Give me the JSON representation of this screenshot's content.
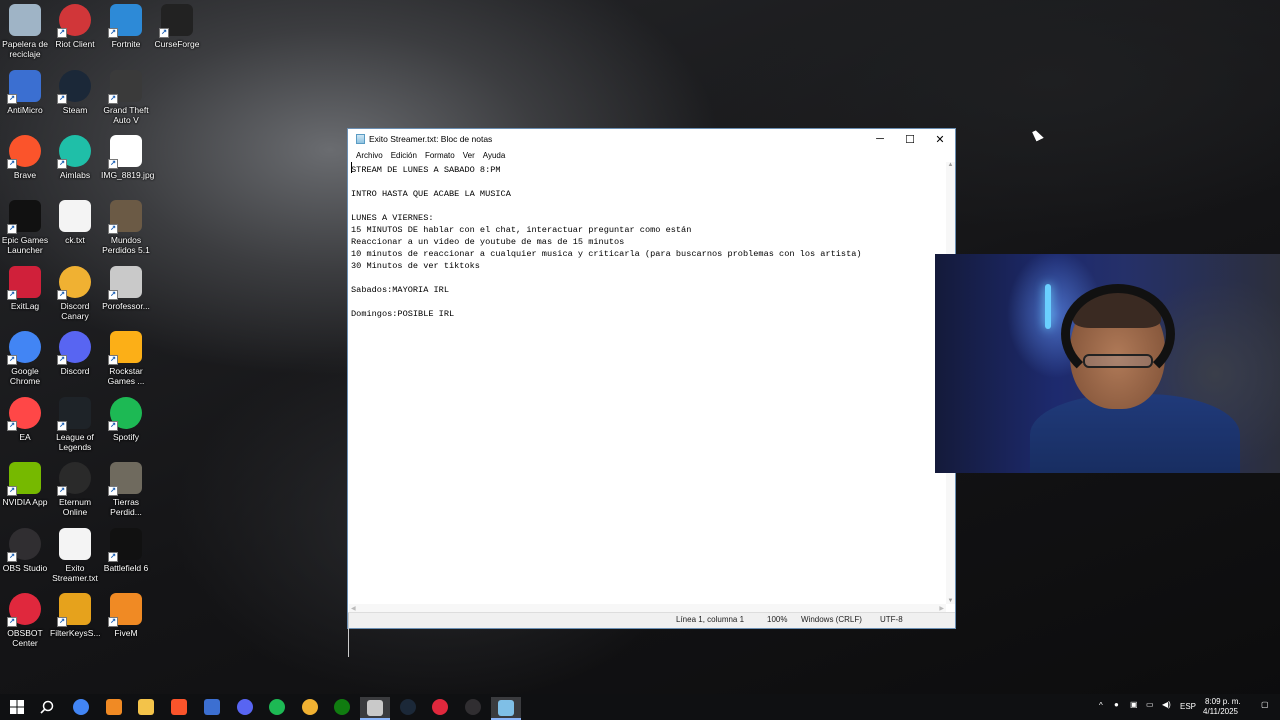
{
  "desktop": {
    "icons": [
      {
        "label": "Papelera de reciclaje",
        "icon": "recycle-bin-icon",
        "color": "#9fb4c6"
      },
      {
        "label": "Riot Client",
        "icon": "riot-client-icon",
        "color": "#d13639"
      },
      {
        "label": "Fortnite",
        "icon": "fortnite-icon",
        "color": "#2d8ad7"
      },
      {
        "label": "CurseForge",
        "icon": "curseforge-icon",
        "color": "#222222"
      },
      {
        "label": "AntiMicro",
        "icon": "antimicro-icon",
        "color": "#3b6fd1"
      },
      {
        "label": "Steam",
        "icon": "steam-icon",
        "color": "#1b2838"
      },
      {
        "label": "Grand Theft Auto V",
        "icon": "gta-v-icon",
        "color": "#3a3a3a"
      },
      {
        "label": "Brave",
        "icon": "brave-icon",
        "color": "#fb542b"
      },
      {
        "label": "Aimlabs",
        "icon": "aimlabs-icon",
        "color": "#1fbfa8"
      },
      {
        "label": "IMG_8819.jpg",
        "icon": "image-file-icon",
        "color": "#ffffff"
      },
      {
        "label": "Epic Games Launcher",
        "icon": "epic-games-icon",
        "color": "#111111"
      },
      {
        "label": "ck.txt",
        "icon": "text-file-icon",
        "color": "#f4f4f4"
      },
      {
        "label": "Mundos Perdidos 5.1",
        "icon": "mundos-perdidos-icon",
        "color": "#6b5a45"
      },
      {
        "label": "ExitLag",
        "icon": "exitlag-icon",
        "color": "#d0203a"
      },
      {
        "label": "Discord Canary",
        "icon": "discord-canary-icon",
        "color": "#f0b132"
      },
      {
        "label": "Porofessor...",
        "icon": "porofessor-icon",
        "color": "#c9c9c9"
      },
      {
        "label": "Google Chrome",
        "icon": "chrome-icon",
        "color": "#4285f4"
      },
      {
        "label": "Discord",
        "icon": "discord-icon",
        "color": "#5865f2"
      },
      {
        "label": "Rockstar Games ...",
        "icon": "rockstar-icon",
        "color": "#fcaf17"
      },
      {
        "label": "EA",
        "icon": "ea-icon",
        "color": "#ff4747"
      },
      {
        "label": "League of Legends",
        "icon": "league-of-legends-icon",
        "color": "#1e2328"
      },
      {
        "label": "Spotify",
        "icon": "spotify-icon",
        "color": "#1db954"
      },
      {
        "label": "NVIDIA App",
        "icon": "nvidia-icon",
        "color": "#76b900"
      },
      {
        "label": "Eternum Online",
        "icon": "eternum-icon",
        "color": "#2a2a2a"
      },
      {
        "label": "Tierras Perdid...",
        "icon": "tierras-perdidas-icon",
        "color": "#6f6a5e"
      },
      {
        "label": "OBS Studio",
        "icon": "obs-icon",
        "color": "#302e31"
      },
      {
        "label": "Exito Streamer.txt",
        "icon": "text-file-icon",
        "color": "#f4f4f4"
      },
      {
        "label": "Battlefield 6",
        "icon": "battlefield-icon",
        "color": "#111111"
      },
      {
        "label": "OBSBOT Center",
        "icon": "obsbot-icon",
        "color": "#e0283d"
      },
      {
        "label": "FilterKeysS...",
        "icon": "filterkeys-icon",
        "color": "#e6a21c"
      },
      {
        "label": "FiveM",
        "icon": "fivem-icon",
        "color": "#f08a24"
      }
    ]
  },
  "notepad": {
    "title": "Exito Streamer.txt: Bloc de notas",
    "controls": {
      "minimize": "─",
      "maximize": "☐",
      "close": "✕"
    },
    "menu": [
      "Archivo",
      "Edición",
      "Formato",
      "Ver",
      "Ayuda"
    ],
    "lines": [
      "STREAM DE LUNES A SABADO 8:PM",
      "",
      "INTRO HASTA QUE ACABE LA MUSICA",
      "",
      "LUNES A VIERNES:",
      "15 MINUTOS DE hablar con el chat, interactuar preguntar como están",
      "Reaccionar a un video de youtube de mas de 15 minutos",
      "10 minutos de reaccionar a cualquier musica y criticarla (para buscarnos problemas con los artista)",
      "30 Minutos de ver tiktoks",
      "",
      "Sabados:MAYORIA IRL",
      "",
      "Domingos:POSIBLE IRL"
    ],
    "status": {
      "position": "Línea 1, columna 1",
      "zoom": "100%",
      "line_ending": "Windows (CRLF)",
      "encoding": "UTF-8"
    }
  },
  "taskbar": {
    "apps": [
      {
        "icon": "chrome-icon",
        "color": "#4285f4"
      },
      {
        "icon": "fivem-icon",
        "color": "#f08a24"
      },
      {
        "icon": "file-explorer-icon",
        "color": "#f3c34a"
      },
      {
        "icon": "brave-icon",
        "color": "#fb542b"
      },
      {
        "icon": "notepad-plus-icon",
        "color": "#3c6fd1"
      },
      {
        "icon": "discord-icon",
        "color": "#5865f2"
      },
      {
        "icon": "spotify-icon",
        "color": "#1db954"
      },
      {
        "icon": "discord-canary-icon",
        "color": "#f0b132"
      },
      {
        "icon": "xbox-icon",
        "color": "#107c10"
      },
      {
        "icon": "porofessor-icon",
        "color": "#c9c9c9"
      },
      {
        "icon": "steam-icon",
        "color": "#1b2838"
      },
      {
        "icon": "obsbot-icon",
        "color": "#e0283d"
      },
      {
        "icon": "obs-icon",
        "color": "#302e31"
      },
      {
        "icon": "notepad-icon",
        "color": "#7fbfe6"
      }
    ],
    "tray": {
      "language": "ESP",
      "time": "8:09 p. m.",
      "date": "4/11/2025"
    }
  }
}
